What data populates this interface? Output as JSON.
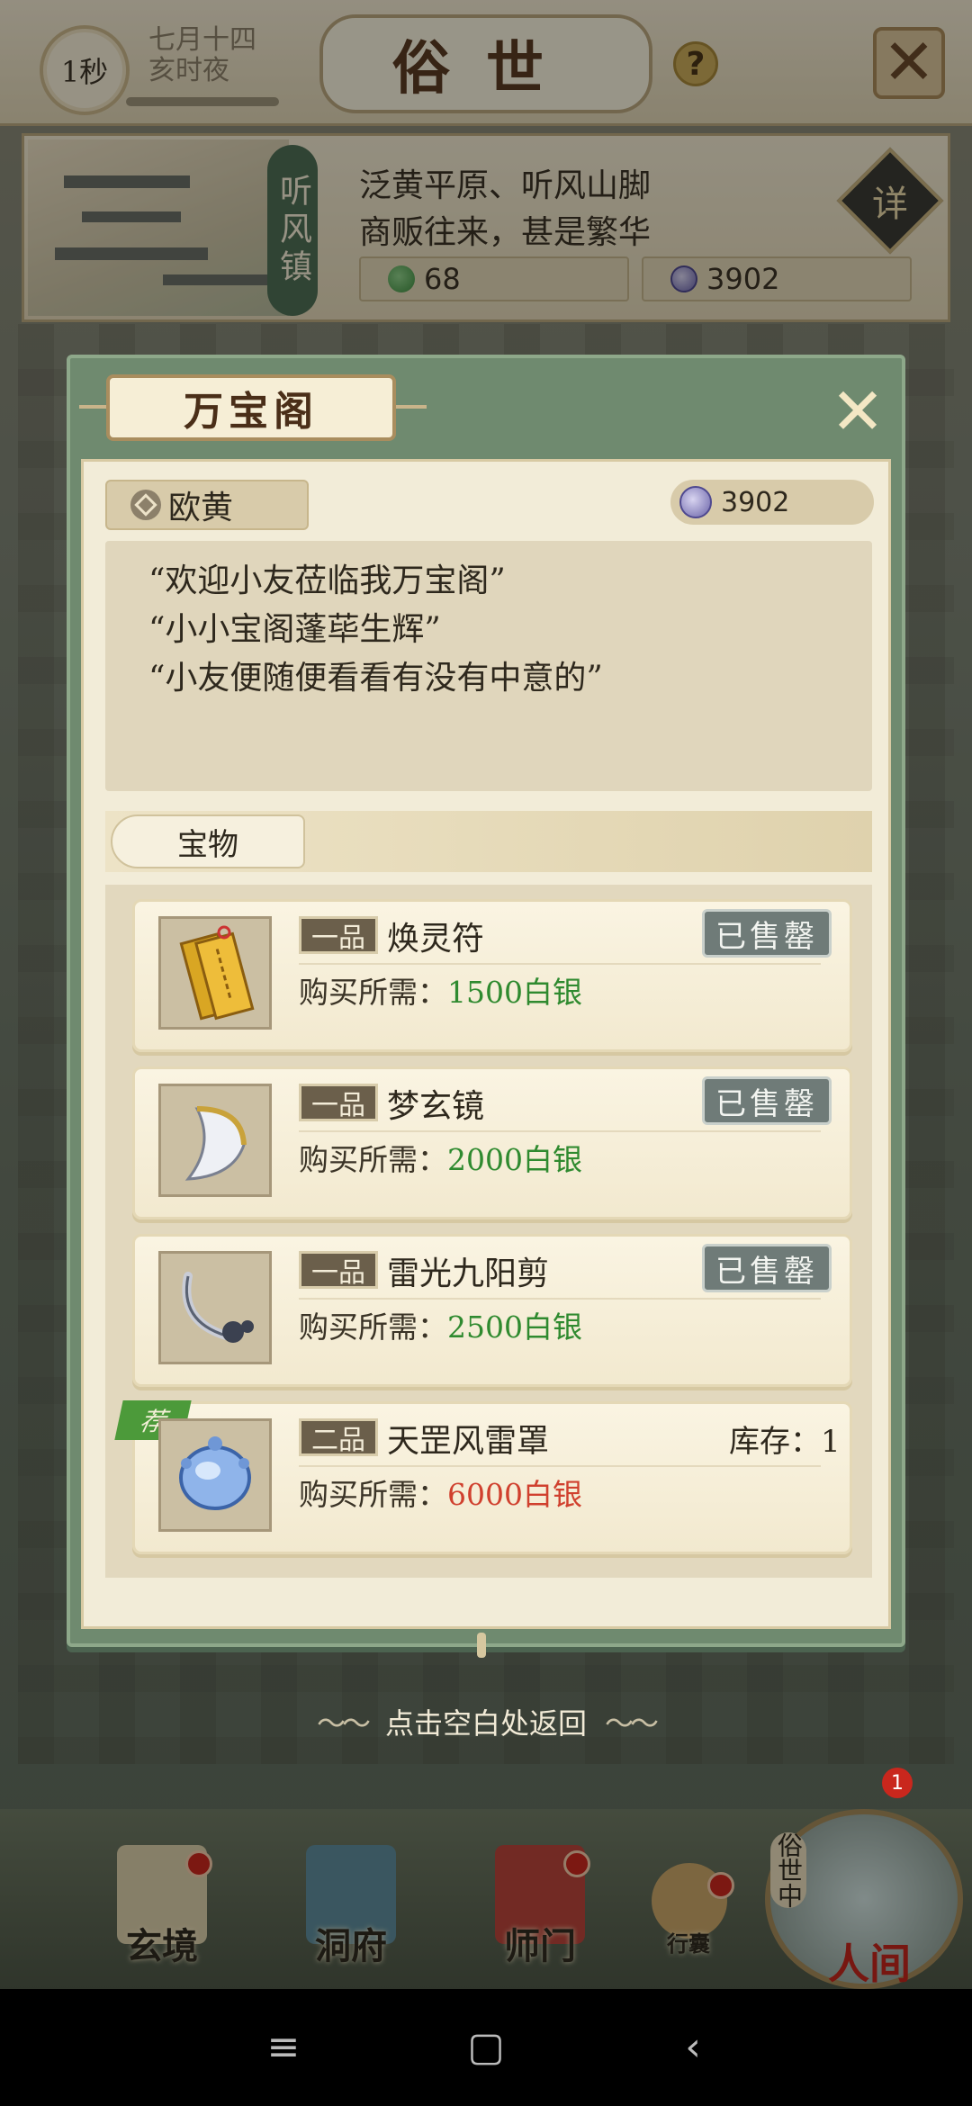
{
  "top_bar": {
    "timer": "1秒",
    "date": "七月十四",
    "time_period": "亥时夜",
    "title": "俗世",
    "help": "?"
  },
  "location": {
    "town_name": "听风镇",
    "description_1": "泛黄平原、听风山脚",
    "description_2": "商贩往来，甚是繁华",
    "spirit_stone": "68",
    "silver": "3902",
    "detail_label": "详"
  },
  "shop": {
    "title": "万宝阁",
    "merchant_name": "欧黄",
    "silver": "3902",
    "greetings": [
      "“欢迎小友莅临我万宝阁”",
      "“小小宝阁蓬荜生辉”",
      "“小友便随便看看有没有中意的”"
    ],
    "section_tab": "宝物",
    "price_prefix": "购买所需：",
    "items": [
      {
        "grade": "一品",
        "name": "焕灵符",
        "price": "1500白银",
        "status": "已售罄",
        "icon": "talisman-icon"
      },
      {
        "grade": "一品",
        "name": "梦玄镜",
        "price": "2000白银",
        "status": "已售罄",
        "icon": "mirror-icon"
      },
      {
        "grade": "一品",
        "name": "雷光九阳剪",
        "price": "2500白银",
        "status": "已售罄",
        "icon": "scissors-icon"
      },
      {
        "grade": "二品",
        "name": "天罡风雷罩",
        "price": "6000白银",
        "stock": "库存：1",
        "recommend": "荐",
        "icon": "shield-icon"
      }
    ]
  },
  "tap_hint": "点击空白处返回",
  "bottom_nav": {
    "items": [
      "玄境",
      "洞府",
      "师门",
      "行囊",
      "人间"
    ],
    "world_vertical": "俗世中",
    "badge": "1"
  },
  "colors": {
    "accent_green": "#2f8a2f",
    "price_red": "#d0402e",
    "modal_frame": "#6f8a6f"
  }
}
